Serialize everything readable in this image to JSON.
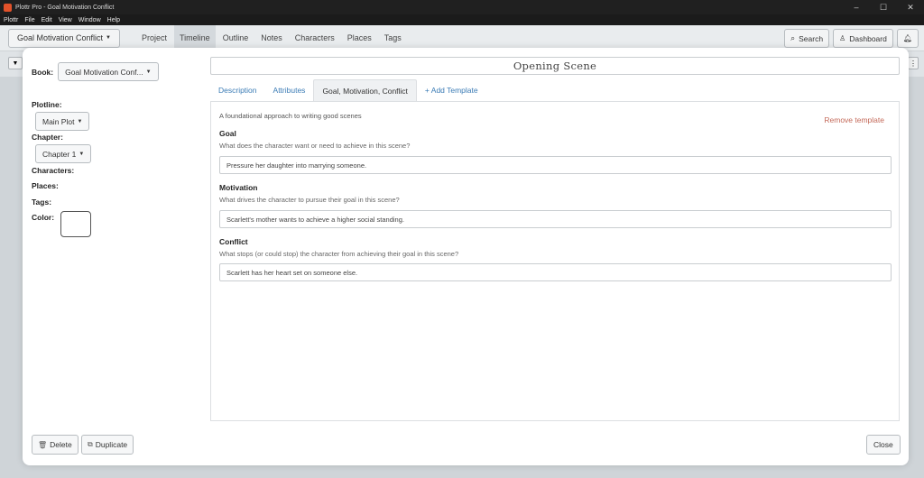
{
  "window": {
    "title": "Plottr Pro - Goal Motivation Conflict",
    "controls": {
      "minimize": "–",
      "maximize": "☐",
      "close": "✕"
    }
  },
  "menubar": [
    "Plottr",
    "File",
    "Edit",
    "View",
    "Window",
    "Help"
  ],
  "appnav": {
    "book_selector": "Goal Motivation Conflict",
    "tabs": [
      "Project",
      "Timeline",
      "Outline",
      "Notes",
      "Characters",
      "Places",
      "Tags"
    ],
    "active_tab": "Timeline",
    "search_label": "Search",
    "dashboard_label": "Dashboard"
  },
  "modal": {
    "book_label": "Book:",
    "book_value": "Goal Motivation Conf...",
    "plotline_label": "Plotline:",
    "plotline_value": "Main Plot",
    "chapter_label": "Chapter:",
    "chapter_value": "Chapter 1",
    "characters_label": "Characters:",
    "places_label": "Places:",
    "tags_label": "Tags:",
    "color_label": "Color:",
    "color_value": "#ffffff",
    "scene_title": "Opening Scene",
    "tabs": [
      "Description",
      "Attributes",
      "Goal, Motivation, Conflict",
      "+ Add Template"
    ],
    "active_tab": "Goal, Motivation, Conflict",
    "template_intro": "A foundational approach to writing good scenes",
    "remove_template": "Remove template",
    "sections": [
      {
        "title": "Goal",
        "description": "What does the character want or need to achieve in this scene?",
        "value": "Pressure her daughter into marrying someone."
      },
      {
        "title": "Motivation",
        "description": "What drives the character to pursue their goal in this scene?",
        "value": "Scarlett's mother wants to achieve a higher social standing."
      },
      {
        "title": "Conflict",
        "description": "What stops (or could stop) the character from achieving their goal in this scene?",
        "value": "Scarlett has her heart set on someone else."
      }
    ],
    "delete_label": "Delete",
    "duplicate_label": "Duplicate",
    "close_label": "Close"
  },
  "colors": {
    "link": "#3a7bb5",
    "remove": "#c46a5a",
    "app_icon": "#e2522a"
  }
}
